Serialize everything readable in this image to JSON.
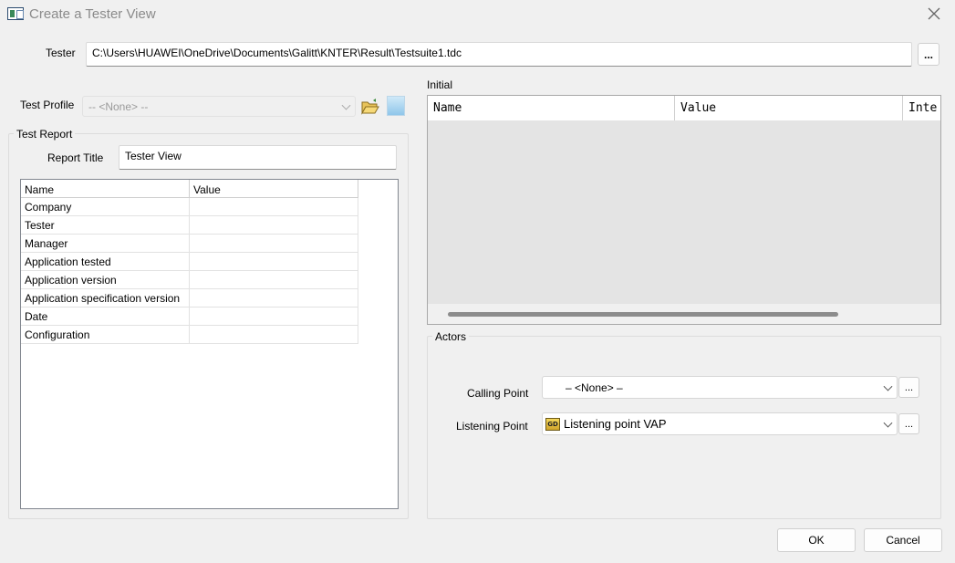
{
  "window": {
    "title": "Create a Tester View"
  },
  "tester": {
    "label": "Tester",
    "path": "C:\\Users\\HUAWEI\\OneDrive\\Documents\\Galitt\\KNTER\\Result\\Testsuite1.tdc",
    "browse_label": "..."
  },
  "test_profile": {
    "label": "Test Profile",
    "value": "-- <None> --"
  },
  "test_report": {
    "group_label": "Test Report",
    "report_title_label": "Report Title",
    "report_title_value": "Tester View",
    "columns": [
      "Name",
      "Value"
    ],
    "rows": [
      {
        "name": "Company",
        "value": ""
      },
      {
        "name": "Tester",
        "value": ""
      },
      {
        "name": "Manager",
        "value": ""
      },
      {
        "name": "Application tested",
        "value": ""
      },
      {
        "name": "Application version",
        "value": ""
      },
      {
        "name": "Application specification version",
        "value": ""
      },
      {
        "name": "Date",
        "value": ""
      },
      {
        "name": "Configuration",
        "value": ""
      }
    ]
  },
  "initial": {
    "label": "Initial",
    "columns": [
      "Name",
      "Value",
      "Inte"
    ]
  },
  "actors": {
    "group_label": "Actors",
    "calling_point": {
      "label": "Calling Point",
      "value": "– <None> –",
      "browse_label": "..."
    },
    "listening_point": {
      "label": "Listening Point",
      "value": "Listening point VAP",
      "icon_text": "GD",
      "browse_label": "..."
    }
  },
  "buttons": {
    "ok": "OK",
    "cancel": "Cancel"
  },
  "icons": {
    "app": "app-window-icon",
    "close": "close-icon",
    "folder": "open-folder-icon",
    "profile": "profile-image-icon",
    "listening": "gd-card-icon"
  }
}
